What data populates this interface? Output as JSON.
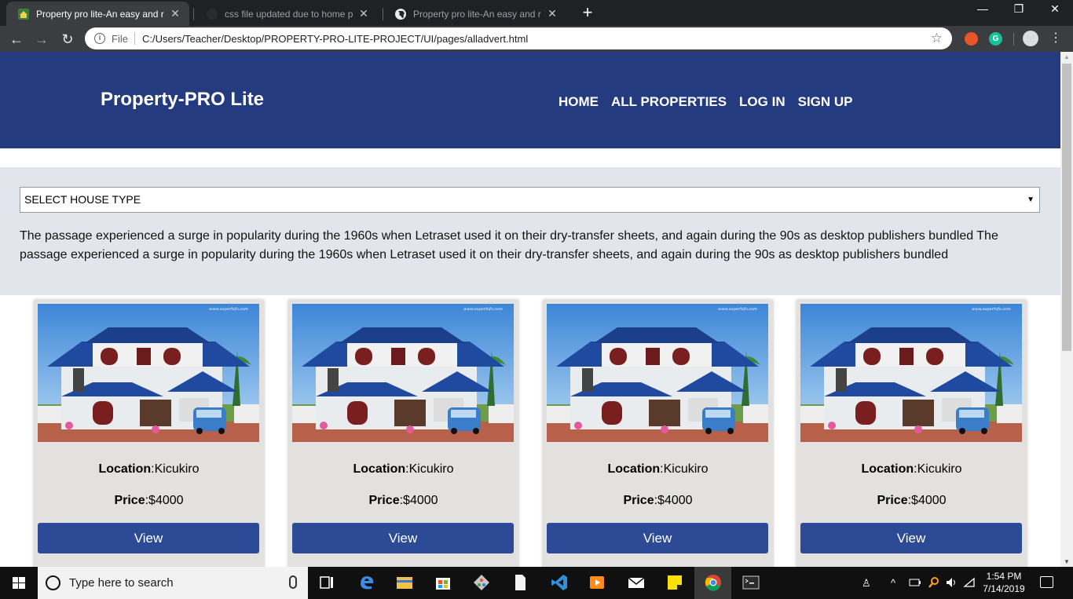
{
  "browser": {
    "tabs": [
      {
        "title": "Property pro lite-An easy and reli",
        "active": true
      },
      {
        "title": "css file updated due to home pag",
        "active": false
      },
      {
        "title": "Property pro lite-An easy and reli",
        "active": false
      }
    ],
    "new_tab": "+",
    "tab_close": "✕",
    "window_controls": {
      "minimize": "—",
      "restore": "❐",
      "close": "✕"
    },
    "address": {
      "scheme_label": "File",
      "url": "C:/Users/Teacher/Desktop/PROPERTY-PRO-LITE-PROJECT/UI/pages/alladvert.html"
    },
    "nav_glyphs": {
      "back": "←",
      "forward": "→",
      "reload": "↻",
      "star": "☆",
      "menu": "⋮"
    }
  },
  "site": {
    "brand": "Property-PRO Lite",
    "nav": [
      "HOME",
      "ALL PROPERTIES",
      "LOG IN",
      "SIGN UP"
    ],
    "filter": {
      "select_value": "SELECT HOUSE TYPE",
      "arrow": "▼"
    },
    "intro": "The passage experienced a surge in popularity during the 1960s when Letraset used it on their dry-transfer sheets, and again during the 90s as desktop publishers bundled The passage experienced a surge in popularity during the 1960s when Letraset used it on their dry-transfer sheets, and again during the 90s as desktop publishers bundled",
    "cards": [
      {
        "location_label": "Location",
        "location": ":Kicukiro",
        "price_label": "Price",
        "price": ":$4000",
        "button": "View",
        "watermark": "www.superhifo.com"
      },
      {
        "location_label": "Location",
        "location": ":Kicukiro",
        "price_label": "Price",
        "price": ":$4000",
        "button": "View",
        "watermark": "www.superhifo.com"
      },
      {
        "location_label": "Location",
        "location": ":Kicukiro",
        "price_label": "Price",
        "price": ":$4000",
        "button": "View",
        "watermark": "www.superhifo.com"
      },
      {
        "location_label": "Location",
        "location": ":Kicukiro",
        "price_label": "Price",
        "price": ":$4000",
        "button": "View",
        "watermark": "www.superhifo.com"
      }
    ],
    "colors": {
      "header": "#243b80",
      "button": "#2c4a95",
      "band": "#e3e5ec",
      "card": "#e2e1df"
    }
  },
  "taskbar": {
    "search_placeholder": "Type here to search",
    "time": "1:54 PM",
    "date": "7/14/2019",
    "pinned_icons": [
      "task-view-icon",
      "edge-icon",
      "file-explorer-icon",
      "store-icon",
      "git-icon",
      "notepad-icon",
      "vscode-icon",
      "media-player-icon",
      "mail-icon",
      "sticky-notes-icon",
      "chrome-icon",
      "terminal-icon"
    ]
  }
}
